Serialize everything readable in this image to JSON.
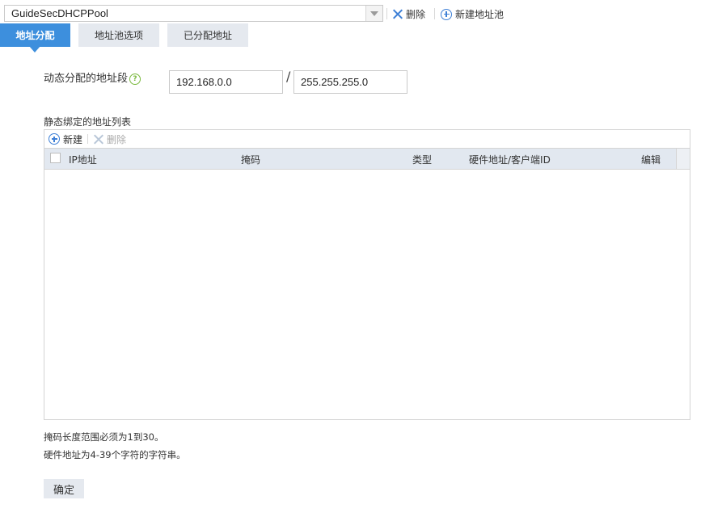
{
  "pool_selector": {
    "selected": "GuideSecDHCPPool"
  },
  "toolbar": {
    "delete_label": "删除",
    "new_pool_label": "新建地址池"
  },
  "tabs": [
    {
      "label": "地址分配",
      "active": true
    },
    {
      "label": "地址池选项",
      "active": false
    },
    {
      "label": "已分配地址",
      "active": false
    }
  ],
  "dynamic_range": {
    "label": "动态分配的地址段",
    "help_icon_text": "?",
    "network": "192.168.0.0",
    "separator": "/",
    "mask": "255.255.255.0"
  },
  "static_list": {
    "title": "静态绑定的地址列表",
    "new_label": "新建",
    "delete_label": "删除",
    "columns": [
      "IP地址",
      "掩码",
      "类型",
      "硬件地址/客户端ID",
      "编辑"
    ],
    "rows": []
  },
  "notes": [
    "掩码长度范围必须为1到30。",
    "硬件地址为4-39个字符的字符串。"
  ],
  "confirm_label": "确定",
  "colors": {
    "accent": "#3d8fdd",
    "tab_inactive": "#e5e9ef",
    "icon_blue": "#3d7fd6",
    "help_green": "#7ab93e",
    "header_bg": "#e2e8f0"
  }
}
